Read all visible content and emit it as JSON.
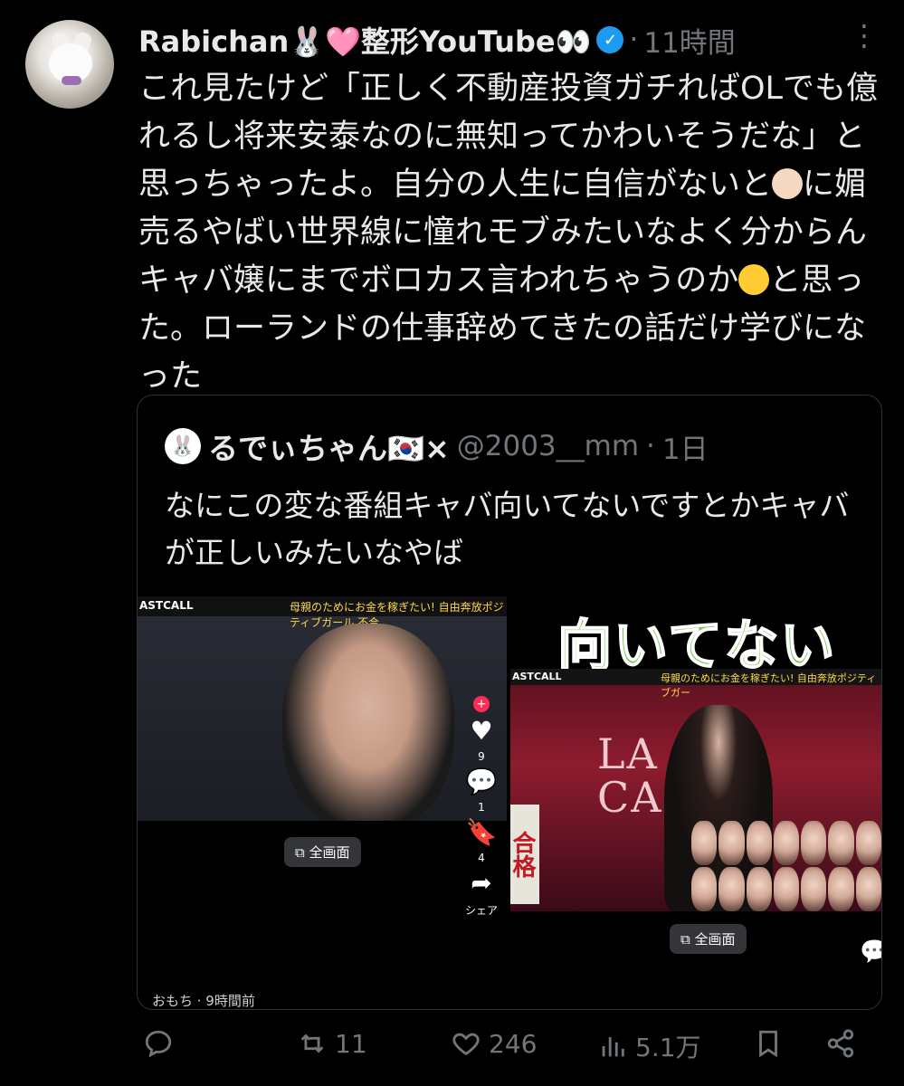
{
  "tweet": {
    "display_name": "Rabichan🐰🩷整形YouTube👀",
    "separator": "·",
    "time": "11時間",
    "more": "⋮",
    "text_parts": [
      "これ見たけど「正しく不動産投資ガチればOLでも億れるし将来安泰なのに無知ってかわいそうだな」と思っちゃったよ。自分の人生に自信がないと",
      "に媚売るやばい世界線に憧れモブみたいなよく分からんキャバ嬢にまでボロカス言われちゃうのか",
      "と思った。ローランドの仕事辞めてきたの話だけ学びになった"
    ],
    "emoji_1": "older-man-emoji",
    "emoji_2": "smiling-face-with-tear-emoji"
  },
  "quote": {
    "display_name": "るでぃちゃん🇰🇷×",
    "handle": "@2003__mm",
    "separator": "·",
    "time": "1日",
    "text": "なにこの変な番組キャバ向いてないですとかキャバが正しいみたいなやば",
    "media_left": {
      "banner_left": "ASTCALL",
      "banner_right": "母親のためにお金を稼ぎたい! 自由奔放ポジティブガール 不合",
      "like_count": "9",
      "comment_count": "1",
      "bookmark_count": "4",
      "share_label": "シェア",
      "fullscreen_label": "全画面",
      "author": "おもち · 9時間前"
    },
    "media_right": {
      "overlay_text": "向いてない",
      "banner_left": "ASTCALL",
      "banner_right": "母親のためにお金を稼ぎたい! 自由奔放ポジティブガー",
      "stage_text": "LA\nCA",
      "badge": "合格",
      "fullscreen_label": "全画面"
    }
  },
  "actions": {
    "reply_count": "",
    "retweet_count": "11",
    "like_count": "246",
    "views_count": "5.1万"
  },
  "colors": {
    "background": "#000000",
    "text": "#e7e9ea",
    "muted": "#71767b",
    "verified": "#1d9bf0",
    "overlay_green": "#78c650"
  }
}
